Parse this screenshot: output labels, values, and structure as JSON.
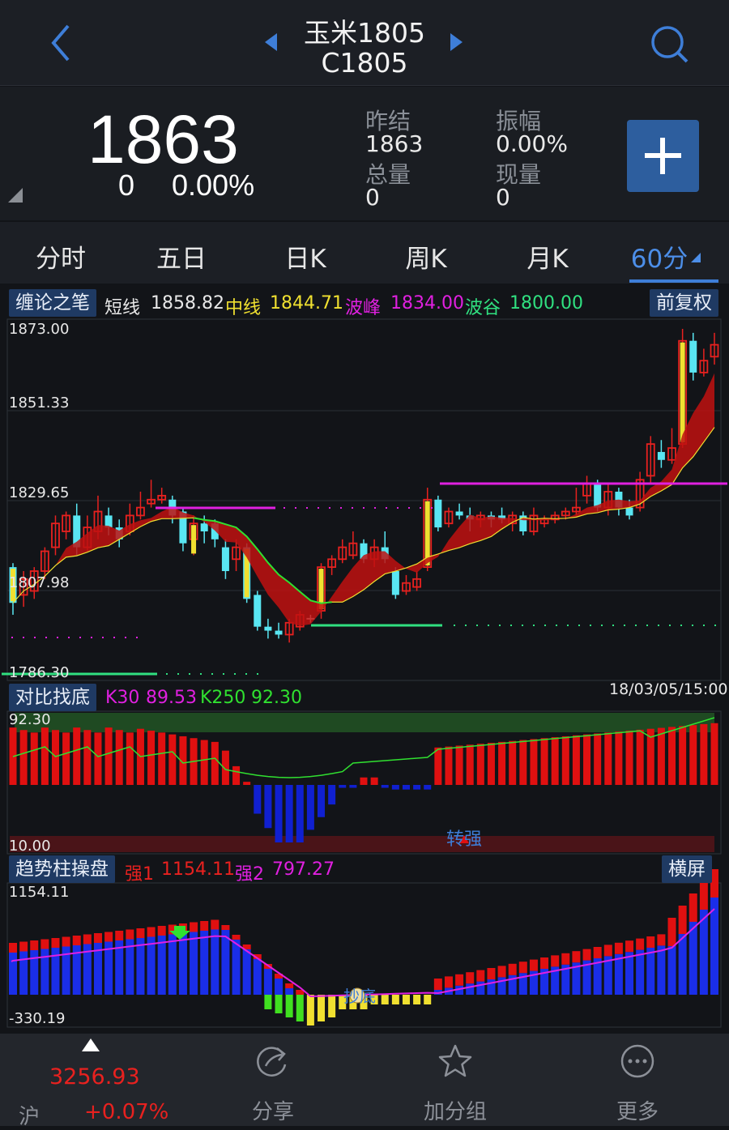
{
  "header": {
    "title": "玉米1805",
    "code": "C1805"
  },
  "quote": {
    "price": "1863",
    "change": "0",
    "change_pct": "0.00%",
    "prev_settle_label": "昨结",
    "prev_settle": "1863",
    "amplitude_label": "振幅",
    "amplitude": "0.00%",
    "volume_label": "总量",
    "volume": "0",
    "current_vol_label": "现量",
    "current_vol": "0"
  },
  "tabs": [
    {
      "label": "分时"
    },
    {
      "label": "五日"
    },
    {
      "label": "日K"
    },
    {
      "label": "周K"
    },
    {
      "label": "月K"
    },
    {
      "label": "60分"
    }
  ],
  "main_panel": {
    "tag": "缠论之笔",
    "short_label": "短线",
    "short": "1858.82",
    "mid_label": "中线",
    "mid": "1844.71",
    "peak_label": "波峰",
    "peak": "1834.00",
    "trough_label": "波谷",
    "trough": "1800.00",
    "adjust_button": "前复权",
    "y_ticks": [
      "1873.00",
      "1851.33",
      "1829.65",
      "1807.98",
      "1786.30"
    ]
  },
  "kd_panel": {
    "tag": "对比找底",
    "k30_label": "K30",
    "k30": "89.53",
    "k250_label": "K250",
    "k250": "92.30",
    "datetime": "18/03/05/15:00",
    "y_top": "92.30",
    "y_bottom": "10.00",
    "signal": "转强"
  },
  "trend_panel": {
    "tag": "趋势柱操盘",
    "s1_label": "强1",
    "s1": "1154.11",
    "s2_label": "强2",
    "s2": "797.27",
    "landscape_button": "横屏",
    "y_top": "1154.11",
    "y_bottom": "-330.19",
    "signal": "抄底"
  },
  "bottom_bar": {
    "index_value": "3256.93",
    "index_name": "沪",
    "index_pct": "+0.07%",
    "share": "分享",
    "add_group": "加分组",
    "more": "更多"
  },
  "colors": {
    "up": "#e8211f",
    "down": "#59e6f2",
    "accent": "#3e7ed8",
    "mid_line": "#f0e030",
    "peak": "#e020e0",
    "trough": "#30e080"
  }
}
